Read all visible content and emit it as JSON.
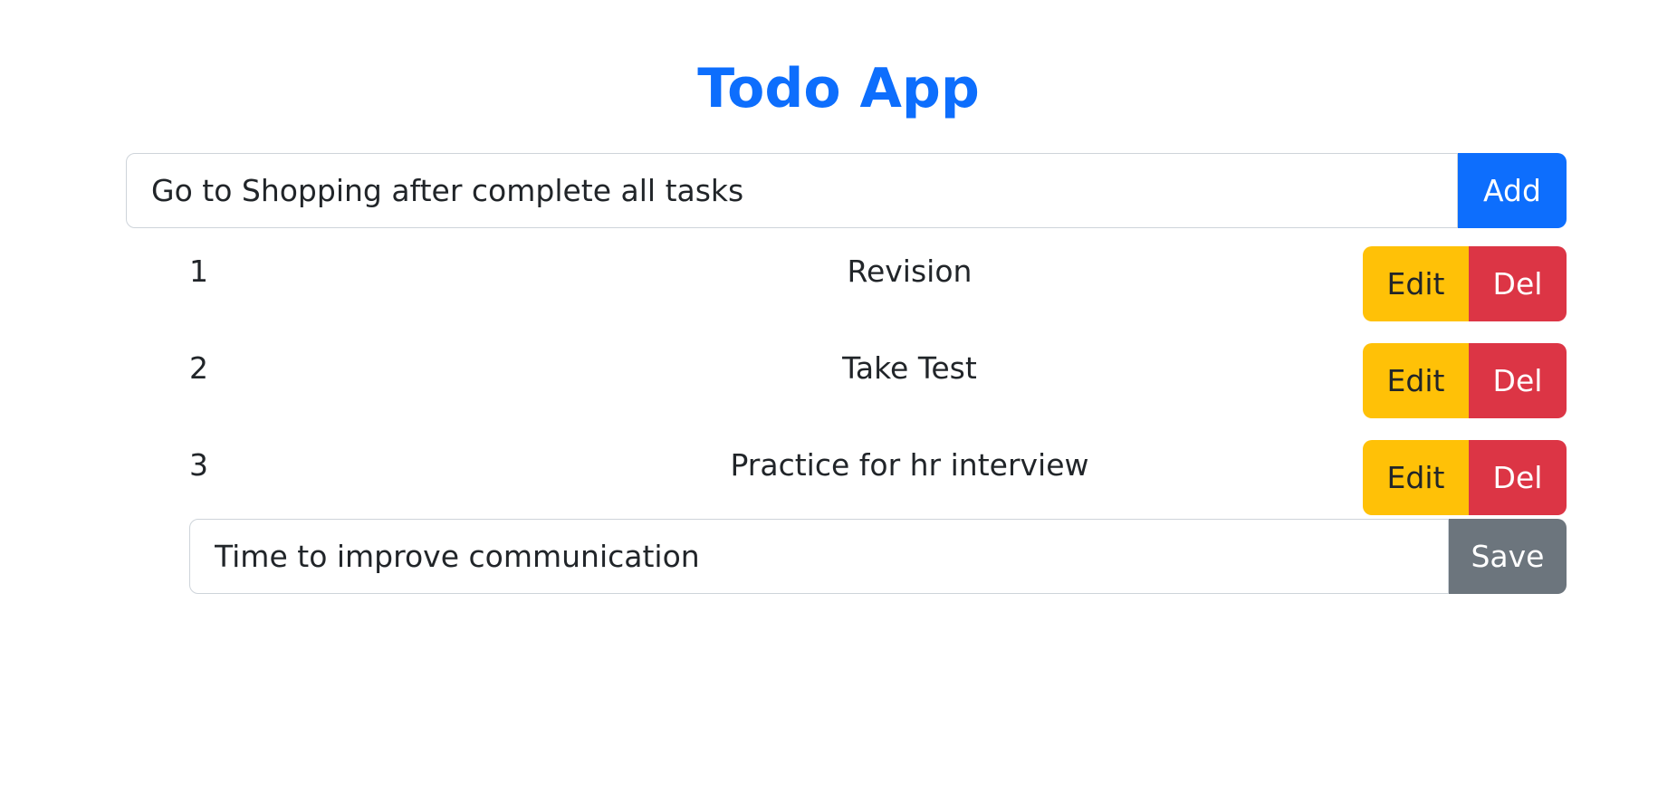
{
  "app": {
    "title": "Todo App"
  },
  "add_form": {
    "input_value": "Go to Shopping after complete all tasks",
    "add_label": "Add"
  },
  "todos": [
    {
      "number": "1",
      "text": "Revision",
      "edit_label": "Edit",
      "delete_label": "Del"
    },
    {
      "number": "2",
      "text": "Take Test",
      "edit_label": "Edit",
      "delete_label": "Del"
    },
    {
      "number": "3",
      "text": "Practice for hr interview",
      "edit_label": "Edit",
      "delete_label": "Del"
    }
  ],
  "edit_form": {
    "input_value": "Time to improve communication",
    "save_label": "Save"
  },
  "colors": {
    "primary": "#0d6efd",
    "warning": "#ffc107",
    "danger": "#dc3545",
    "secondary": "#6c757d"
  }
}
